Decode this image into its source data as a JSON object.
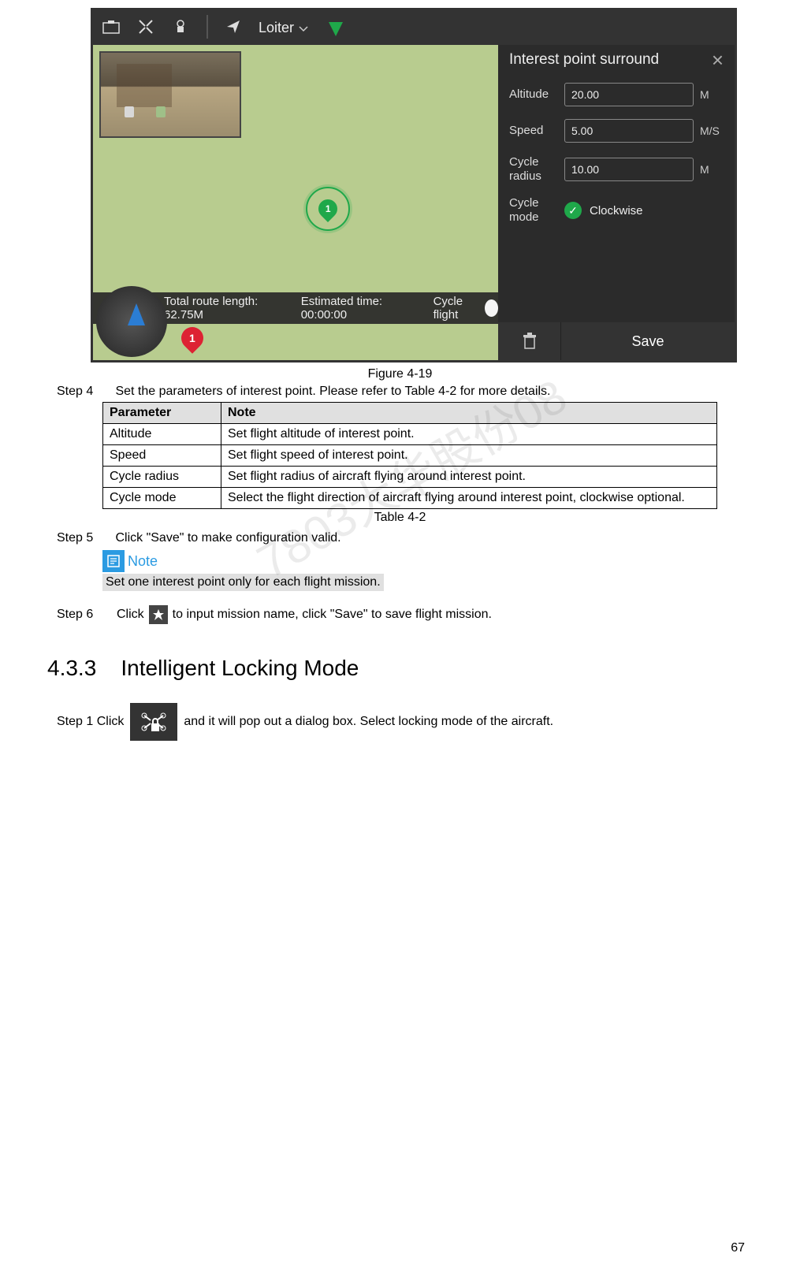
{
  "screenshot": {
    "topbar": {
      "mode_label": "Loiter"
    },
    "status": {
      "route_label": "Total route length: 62.75M",
      "time_label": "Estimated time: 00:00:00",
      "cycle_label": "Cycle flight"
    },
    "map": {
      "markerNumber": "1",
      "redMarkerNumber": "1"
    },
    "panel": {
      "title": "Interest point surround",
      "close": "×",
      "rows": [
        {
          "label": "Altitude",
          "value": "20.00",
          "unit": "M"
        },
        {
          "label": "Speed",
          "value": "5.00",
          "unit": "M/S"
        },
        {
          "label": "Cycle radius",
          "value": "10.00",
          "unit": "M"
        }
      ],
      "cycleModeLabel": "Cycle mode",
      "cycleModeValue": "Clockwise",
      "saveLabel": "Save"
    }
  },
  "figureCaption": "Figure 4-19",
  "step4": {
    "label": "Step 4",
    "text": "Set the parameters of interest point. Please refer to Table 4-2 for more details."
  },
  "table": {
    "headers": [
      "Parameter",
      "Note"
    ],
    "rows": [
      [
        "Altitude",
        "Set flight altitude of interest point."
      ],
      [
        "Speed",
        "Set flight speed of interest point."
      ],
      [
        "Cycle radius",
        "Set flight radius of aircraft flying around interest point."
      ],
      [
        "Cycle mode",
        "Select the flight direction of aircraft flying around interest point, clockwise optional."
      ]
    ],
    "caption": "Table 4-2"
  },
  "step5": {
    "label": "Step 5",
    "text": "Click \"Save\" to make configuration valid."
  },
  "note": {
    "label": "Note",
    "text": "Set one interest point only for each flight mission."
  },
  "step6": {
    "label": "Step 6",
    "pre": "Click",
    "post": "to input mission name, click \"Save\" to save flight mission."
  },
  "section": {
    "number": "4.3.3",
    "title": "Intelligent Locking Mode"
  },
  "step1": {
    "label": "Step 1 Click",
    "post": "and it will pop out a dialog box. Select locking mode of the aircraft."
  },
  "watermark": "7803大华股份08",
  "pageNumber": "67"
}
